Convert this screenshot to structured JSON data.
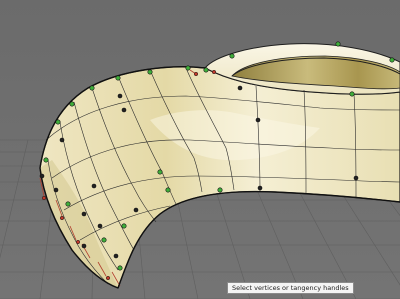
{
  "viewport": {
    "background_color": "#707070",
    "grid_color": "#5c5c5c",
    "surface_colors": {
      "light": "#f3edd0",
      "mid": "#d9cf9a",
      "dark": "#9a8a48",
      "edge": "#1e1e1e",
      "wire": "#2a2a2a",
      "vertex_green": "#3fae3a",
      "vertex_dark": "#222222",
      "tangent_red": "#c0392b"
    }
  },
  "status": {
    "tooltip": "Select vertices or tangency handles"
  }
}
